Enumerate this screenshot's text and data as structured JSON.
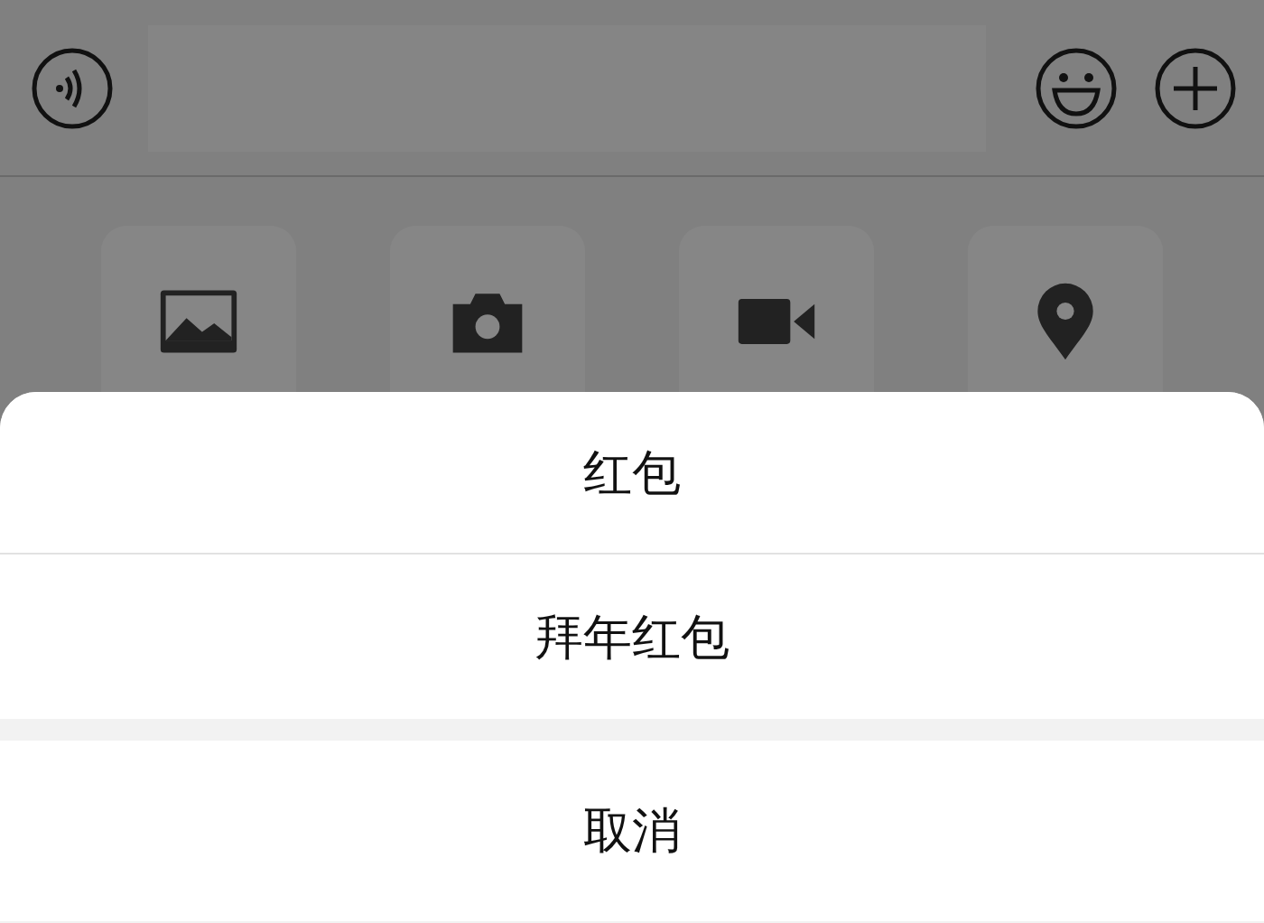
{
  "panel": {
    "tiles": [
      {
        "kind": "photo"
      },
      {
        "kind": "camera"
      },
      {
        "kind": "video"
      },
      {
        "kind": "location"
      }
    ]
  },
  "action_sheet": {
    "options": [
      {
        "label": "红包"
      },
      {
        "label": "拜年红包"
      }
    ],
    "cancel": "取消"
  }
}
